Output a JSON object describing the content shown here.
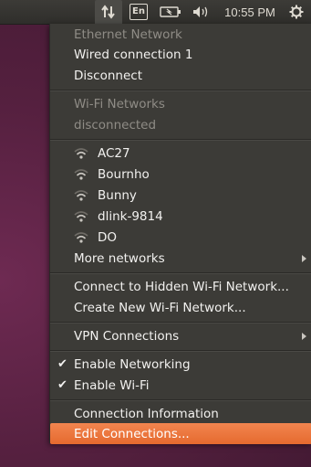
{
  "panel": {
    "keyboard_label": "En",
    "clock": "10:55 PM",
    "icons": [
      "network-arrows-icon",
      "keyboard-layout-icon",
      "battery-icon",
      "volume-icon",
      "session-gear-icon"
    ]
  },
  "menu": {
    "ethernet_header": "Ethernet Network",
    "wired_connection": "Wired connection 1",
    "disconnect": "Disconnect",
    "wifi_header": "Wi-Fi Networks",
    "wifi_status": "disconnected",
    "networks": [
      "AC27",
      "Bournho",
      "Bunny",
      "dlink-9814",
      "DO"
    ],
    "more_networks": "More networks",
    "connect_hidden": "Connect to Hidden Wi-Fi Network...",
    "create_new": "Create New Wi-Fi Network...",
    "vpn": "VPN Connections",
    "enable_networking": "Enable Networking",
    "enable_wifi": "Enable Wi-Fi",
    "connection_info": "Connection Information",
    "edit_connections": "Edit Connections..."
  },
  "colors": {
    "highlight": "#e9763e",
    "menu_bg": "#3c3b37",
    "panel_bg": "#3c3b37"
  }
}
